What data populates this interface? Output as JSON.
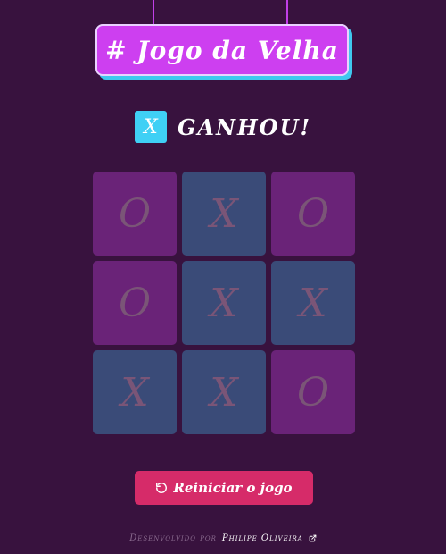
{
  "header": {
    "title": "# Jogo da Velha"
  },
  "status": {
    "winner_symbol": "X",
    "text": "GANHOU!"
  },
  "board": {
    "cells": [
      "O",
      "X",
      "O",
      "O",
      "X",
      "X",
      "X",
      "X",
      "O"
    ]
  },
  "actions": {
    "restart_label": "Reiniciar o jogo",
    "restart_icon": "rotate-ccw-icon"
  },
  "footer": {
    "prefix": "Desenvolvido por",
    "author": "Philipe Oliveira",
    "link_icon": "external-link-icon"
  },
  "colors": {
    "background": "#38123e",
    "title_bg": "#cd3ff0",
    "title_shadow": "#3fc8ee",
    "o_cell": "#6a2378",
    "x_cell": "#3a4b78",
    "badge": "#3fd0f5",
    "button": "#d62b69"
  }
}
